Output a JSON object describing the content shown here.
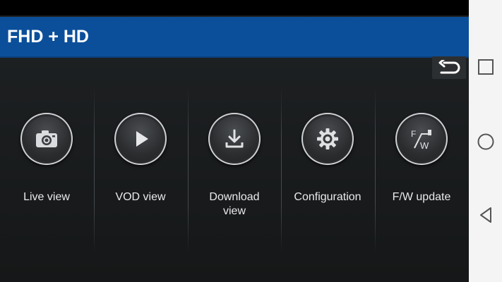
{
  "app": {
    "title": "FHD + HD",
    "colors": {
      "title_bar": "#0b4f9a",
      "background": "#1a1c1e",
      "label": "#eaeaea",
      "nav_bar": "#f4f4f4"
    }
  },
  "toolbar": {
    "back_icon": "back-arrow-icon"
  },
  "menu": {
    "items": [
      {
        "label": "Live view",
        "icon": "camera-icon"
      },
      {
        "label": "VOD view",
        "icon": "play-icon"
      },
      {
        "label": "Download\nview",
        "icon": "download-icon"
      },
      {
        "label": "Configuration",
        "icon": "gear-icon"
      },
      {
        "label": "F/W update",
        "icon": "firmware-update-icon"
      }
    ]
  },
  "navigation": {
    "icons": [
      "recent-apps-icon",
      "home-icon",
      "back-icon"
    ]
  }
}
